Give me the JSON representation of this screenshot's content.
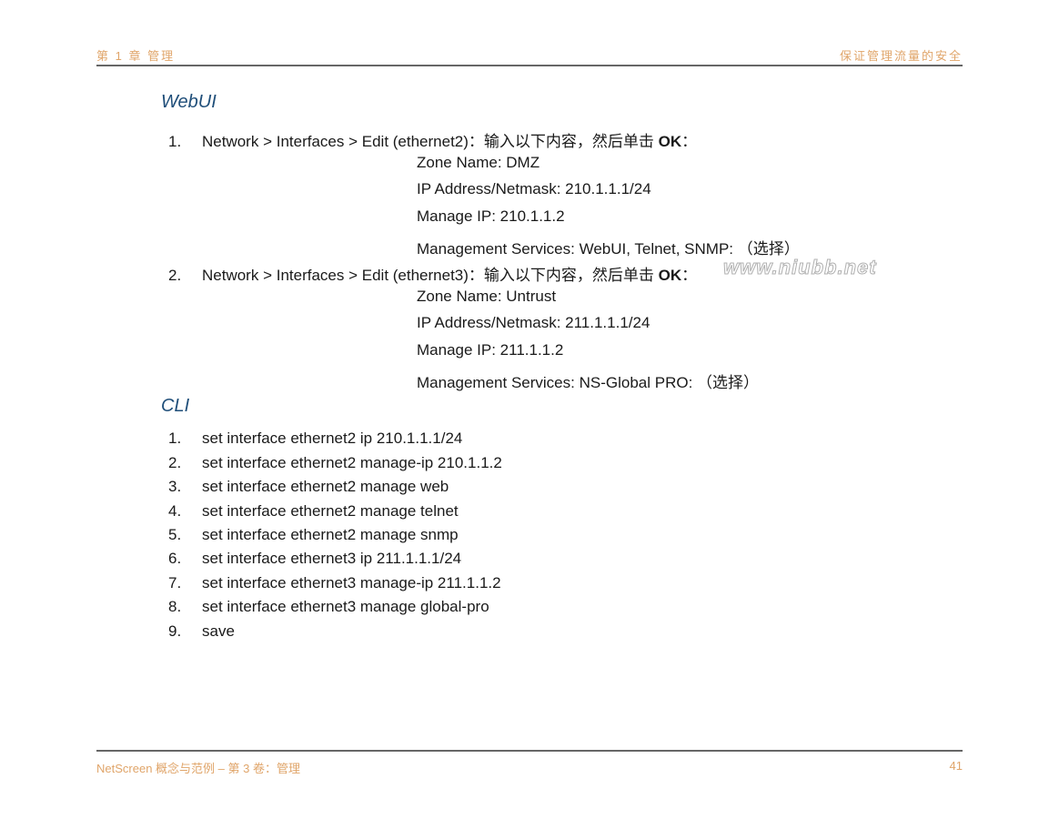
{
  "header": {
    "chapter": "第 1 章 管理",
    "section": "保证管理流量的安全"
  },
  "webui": {
    "title": "WebUI",
    "steps": [
      {
        "num": "1.",
        "path": "Network > Interfaces > Edit (ethernet2)",
        "instruction": "：输入以下内容，然后单击 ",
        "ok": "OK",
        "end": "：",
        "fields": [
          "Zone Name: DMZ",
          "IP Address/Netmask: 210.1.1.1/24",
          "Manage IP: 210.1.1.2",
          "Management Services: WebUI, Telnet, SNMP: （选择）"
        ]
      },
      {
        "num": "2.",
        "path": "Network > Interfaces > Edit (ethernet3)",
        "instruction": "：输入以下内容，然后单击 ",
        "ok": "OK",
        "end": "：",
        "fields": [
          "Zone Name: Untrust",
          "IP Address/Netmask: 211.1.1.1/24",
          "Manage IP: 211.1.1.2",
          "Management Services: NS-Global PRO: （选择）"
        ]
      }
    ]
  },
  "cli": {
    "title": "CLI",
    "commands": [
      {
        "num": "1.",
        "text": "set interface ethernet2 ip 210.1.1.1/24"
      },
      {
        "num": "2.",
        "text": "set interface ethernet2 manage-ip 210.1.1.2"
      },
      {
        "num": "3.",
        "text": "set interface ethernet2 manage web"
      },
      {
        "num": "4.",
        "text": "set interface ethernet2 manage telnet"
      },
      {
        "num": "5.",
        "text": "set interface ethernet2 manage snmp"
      },
      {
        "num": "6.",
        "text": "set interface ethernet3 ip 211.1.1.1/24"
      },
      {
        "num": "7.",
        "text": "set interface ethernet3 manage-ip 211.1.1.2"
      },
      {
        "num": "8.",
        "text": "set interface ethernet3 manage global-pro"
      },
      {
        "num": "9.",
        "text": "save"
      }
    ]
  },
  "watermark": "www.niubb.net",
  "footer": {
    "book": "NetScreen 概念与范例 – 第 3 卷：管理",
    "page": "41"
  },
  "colors": {
    "accent_orange": "#e0a56a",
    "heading_blue": "#1f4e79"
  }
}
